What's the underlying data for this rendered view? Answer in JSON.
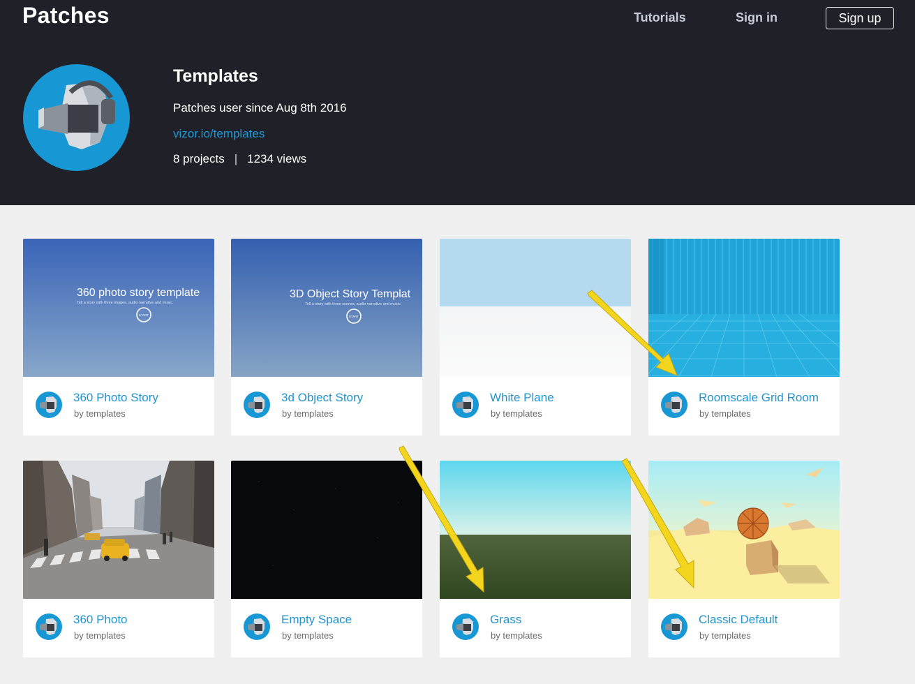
{
  "header": {
    "logo": "Patches",
    "nav": {
      "tutorials": "Tutorials",
      "sign_in": "Sign in",
      "sign_up": "Sign up"
    }
  },
  "profile": {
    "title": "Templates",
    "since": "Patches user since Aug 8th 2016",
    "url": "vizor.io/templates",
    "projects": "8 projects",
    "separator": "|",
    "views": "1234 views"
  },
  "projects": [
    {
      "title": "360 Photo Story",
      "author": "by templates",
      "thumb_title": "360 photo story template",
      "thumb_subtitle": "Tell a story with three images, audio narrative and music.",
      "thumb_button": "START"
    },
    {
      "title": "3d Object Story",
      "author": "by templates",
      "thumb_title": "3D Object Story Templat",
      "thumb_subtitle": "Tell a story with three scenes, audio narrative and music.",
      "thumb_button": "START"
    },
    {
      "title": "White Plane",
      "author": "by templates"
    },
    {
      "title": "Roomscale Grid Room",
      "author": "by templates"
    },
    {
      "title": "360 Photo",
      "author": "by templates"
    },
    {
      "title": "Empty Space",
      "author": "by templates"
    },
    {
      "title": "Grass",
      "author": "by templates"
    },
    {
      "title": "Classic Default",
      "author": "by templates"
    }
  ],
  "colors": {
    "header_bg": "#1f2028",
    "page_bg": "#f0f0f0",
    "link_blue": "#2394cd",
    "avatar_blue": "#1797d3",
    "arrow_yellow": "#f2d51c"
  },
  "icons": {
    "avatar": "vr-headset-head-icon",
    "annotation": "yellow-arrow"
  }
}
